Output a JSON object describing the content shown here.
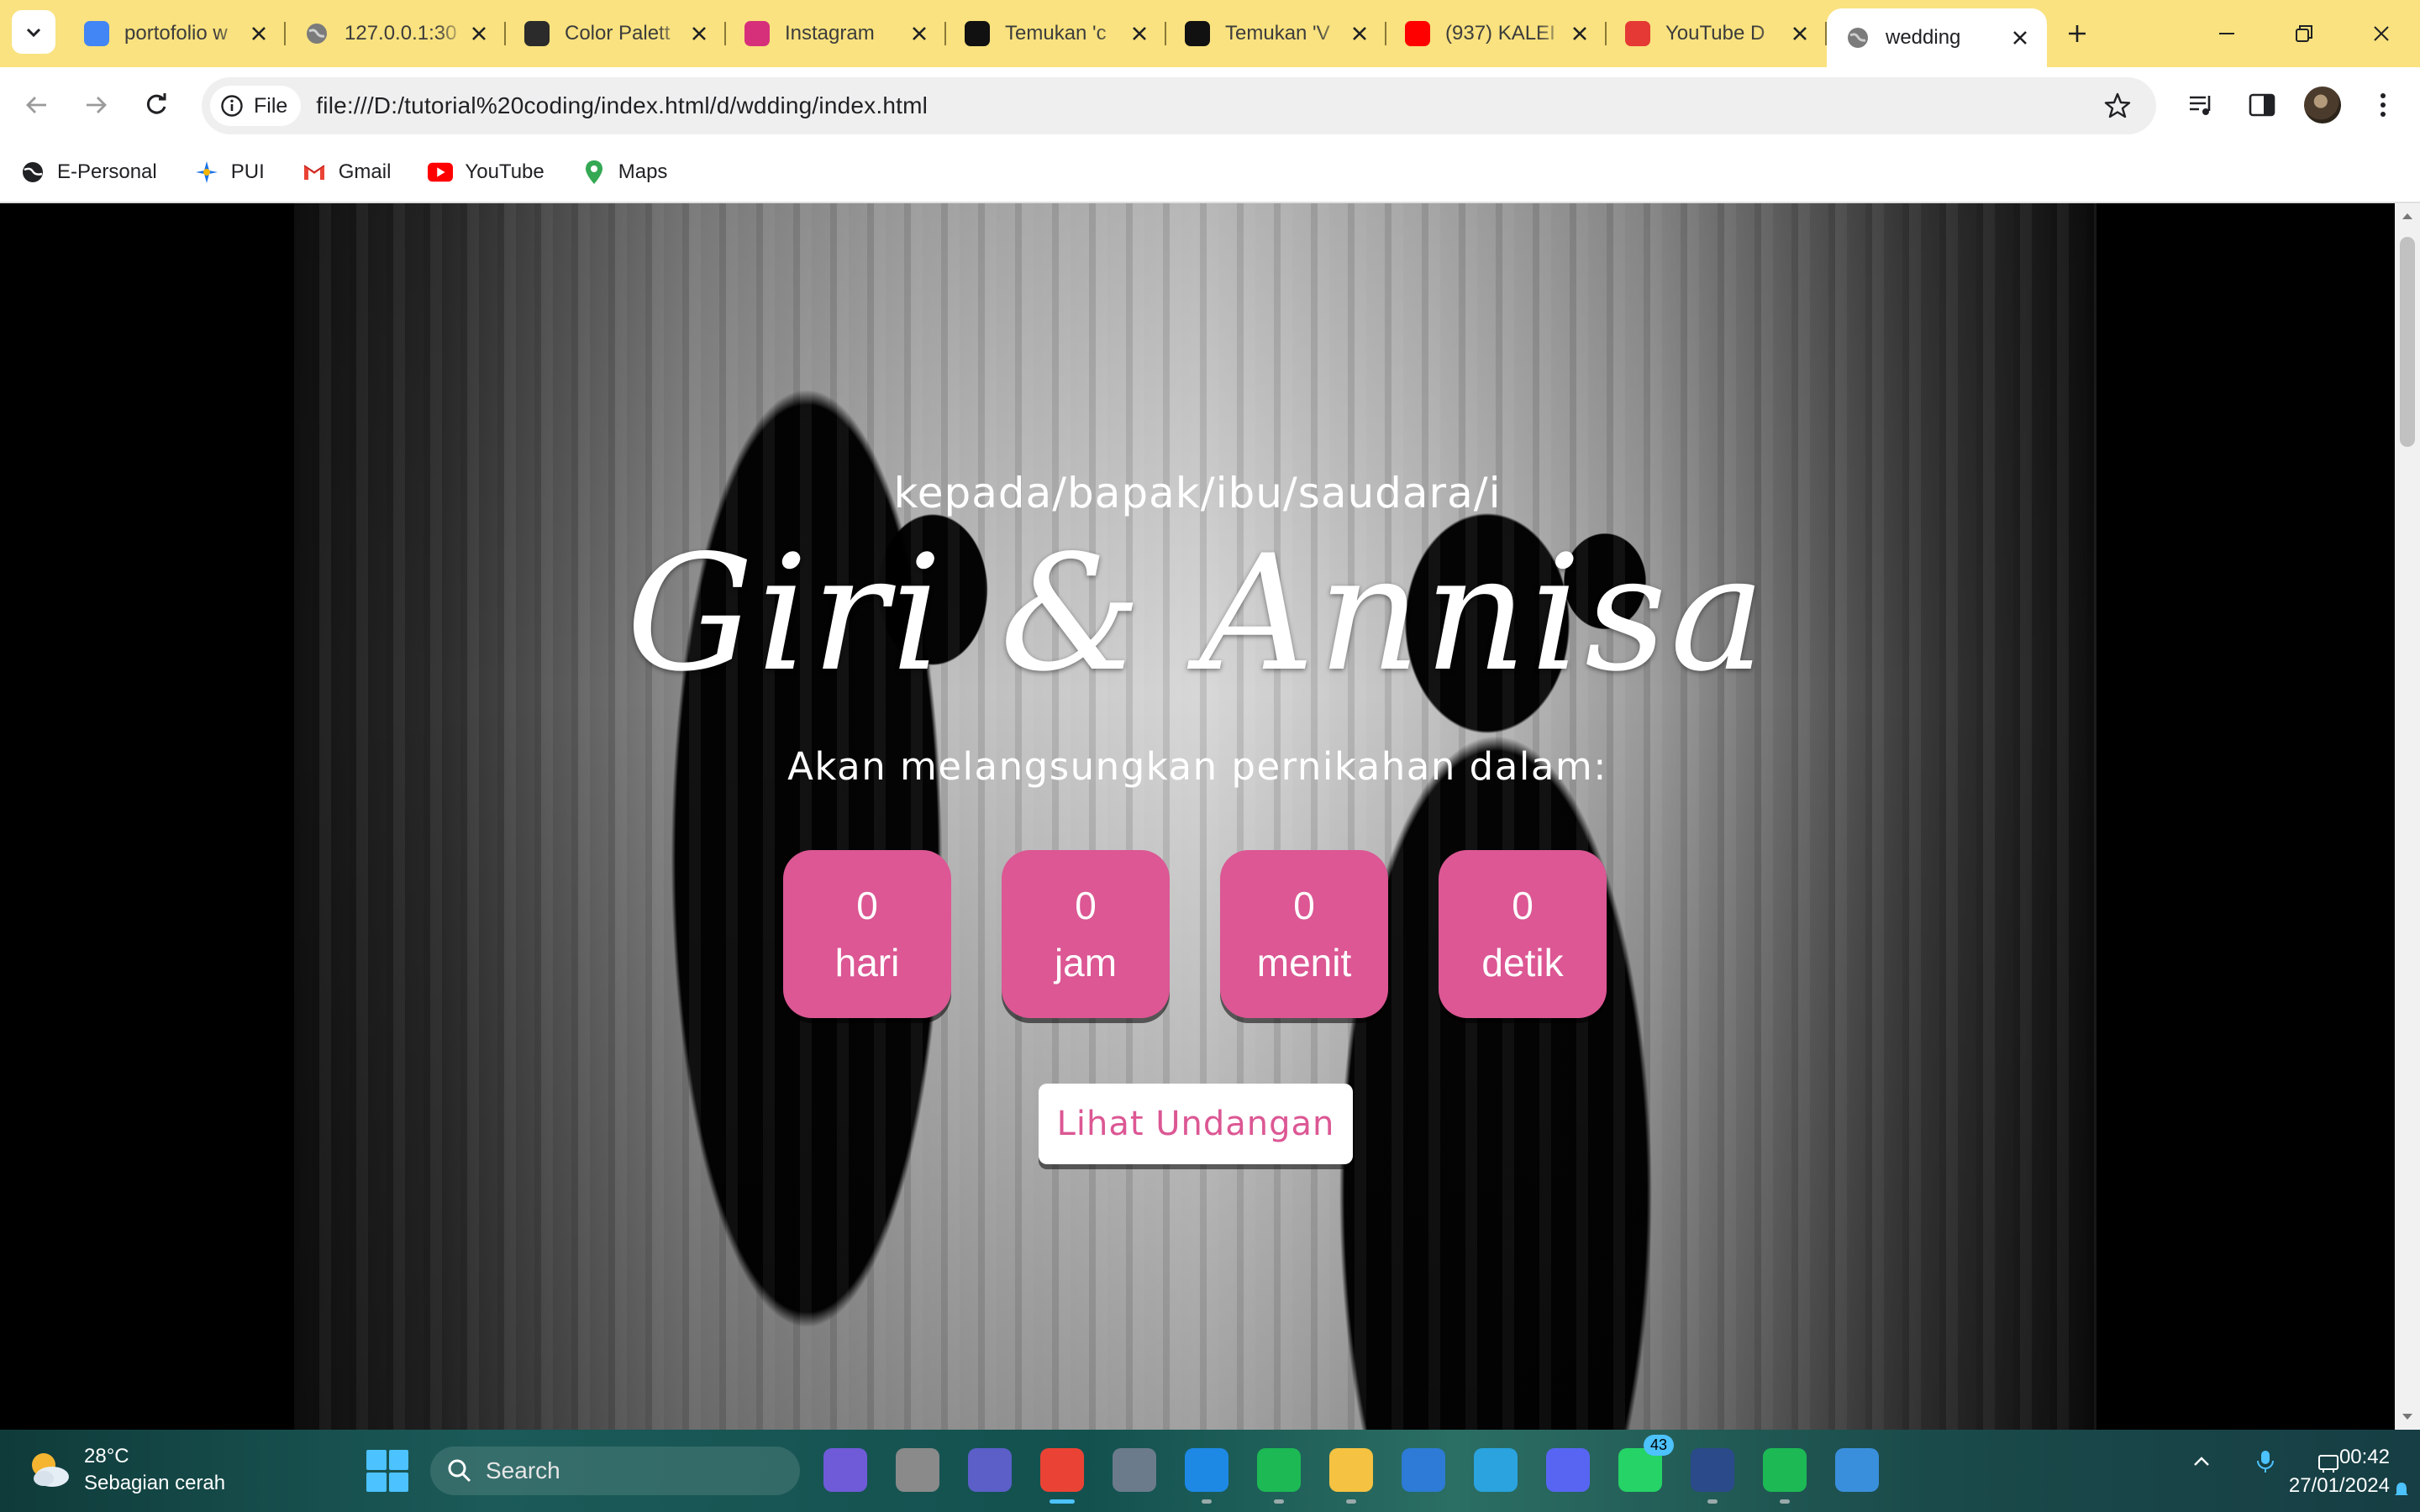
{
  "browser": {
    "tabs": [
      {
        "title": "portofolio w",
        "icon": "google-icon",
        "color": "#4285f4",
        "active": false
      },
      {
        "title": "127.0.0.1:30",
        "icon": "globe-icon",
        "color": "#7b7b7b",
        "active": false
      },
      {
        "title": "Color Palett",
        "icon": "color-palette-icon",
        "color": "#2b2b2b",
        "active": false
      },
      {
        "title": "Instagram",
        "icon": "instagram-icon",
        "color": "#d6307b",
        "active": false
      },
      {
        "title": "Temukan 'c",
        "icon": "tiktok-icon",
        "color": "#111111",
        "active": false
      },
      {
        "title": "Temukan 'V",
        "icon": "tiktok-icon",
        "color": "#111111",
        "active": false
      },
      {
        "title": "(937) KALEI",
        "icon": "youtube-icon",
        "color": "#ff0000",
        "active": false
      },
      {
        "title": "YouTube D",
        "icon": "download-icon",
        "color": "#e53935",
        "active": false
      },
      {
        "title": "wedding",
        "icon": "globe-icon",
        "color": "#7b7b7b",
        "active": true
      }
    ],
    "site_chip": "File",
    "url": "file:///D:/tutorial%20coding/index.html/d/wdding/index.html",
    "bookmarks": [
      {
        "label": "E-Personal",
        "icon": "globe-icon"
      },
      {
        "label": "PUI",
        "icon": "pui-icon"
      },
      {
        "label": "Gmail",
        "icon": "gmail-icon"
      },
      {
        "label": "YouTube",
        "icon": "youtube-icon"
      },
      {
        "label": "Maps",
        "icon": "maps-icon"
      }
    ]
  },
  "page": {
    "greeting": "kepada/bapak/ibu/saudara/i",
    "names": "Giri & Annisa",
    "tagline": "Akan melangsungkan pernikahan dalam:",
    "countdown": [
      {
        "value": "0",
        "unit": "hari"
      },
      {
        "value": "0",
        "unit": "jam"
      },
      {
        "value": "0",
        "unit": "menit"
      },
      {
        "value": "0",
        "unit": "detik"
      }
    ],
    "cta_label": "Lihat Undangan",
    "accent_color": "#dc5794"
  },
  "taskbar": {
    "weather_temp": "28°C",
    "weather_desc": "Sebagian cerah",
    "search_placeholder": "Search",
    "apps": [
      {
        "name": "copilot",
        "color": "#6f5bd8",
        "label": ""
      },
      {
        "name": "file-explorer-alt",
        "color": "#8a8a8a",
        "label": ""
      },
      {
        "name": "teams",
        "color": "#5b5fc7",
        "label": ""
      },
      {
        "name": "chrome",
        "color": "#ea4335",
        "label": ""
      },
      {
        "name": "settings",
        "color": "#6b7b8c",
        "label": ""
      },
      {
        "name": "vscode",
        "color": "#1e88e5",
        "label": ""
      },
      {
        "name": "spotify",
        "color": "#1db954",
        "label": ""
      },
      {
        "name": "file-explorer",
        "color": "#f5c242",
        "label": ""
      },
      {
        "name": "microsoft-store",
        "color": "#2d7bd6",
        "label": ""
      },
      {
        "name": "telegram",
        "color": "#2aa3df",
        "label": ""
      },
      {
        "name": "discord",
        "color": "#5865f2",
        "label": ""
      },
      {
        "name": "whatsapp",
        "color": "#25d366",
        "label": "",
        "badge": "43"
      },
      {
        "name": "powershell",
        "color": "#2b4a8a",
        "label": ""
      },
      {
        "name": "spotify-2",
        "color": "#1db954",
        "label": ""
      },
      {
        "name": "photos",
        "color": "#3a8fdc",
        "label": ""
      }
    ],
    "time": "00:42",
    "date": "27/01/2024"
  }
}
